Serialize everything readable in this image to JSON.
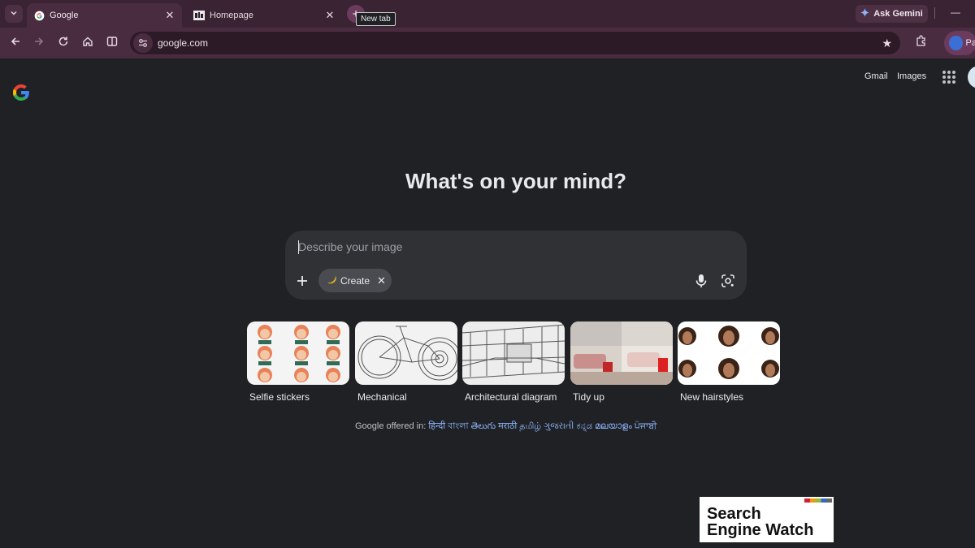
{
  "browser": {
    "tabs": [
      {
        "title": "Google",
        "active": true
      },
      {
        "title": "Homepage",
        "active": false
      }
    ],
    "new_tab_tooltip": "New tab",
    "ask_gemini": "Ask Gemini",
    "url": "google.com",
    "profile_label": "Pa"
  },
  "header": {
    "gmail": "Gmail",
    "images": "Images"
  },
  "main": {
    "heading": "What's on your mind?",
    "search_placeholder": "Describe your image",
    "create_chip": "Create"
  },
  "suggestions": [
    {
      "label": "Selfie stickers"
    },
    {
      "label": "Mechanical"
    },
    {
      "label": "Architectural diagram"
    },
    {
      "label": "Tidy up"
    },
    {
      "label": "New hairstyles"
    }
  ],
  "footer": {
    "offered_in": "Google offered in:",
    "languages": "हिन्दी বাংলা తెలుగు मराठी தமிழ் ગુજરાતી ಕನ್ನಡ മലയാളം ਪੰਜਾਬੀ"
  },
  "watermark": {
    "line1": "Search",
    "line2": "Engine Watch"
  },
  "colors": {
    "page_bg": "#202124",
    "tab_strip": "#3a2332",
    "toolbar": "#4a2c40",
    "search_box": "#303134",
    "link": "#8ab4f8"
  }
}
